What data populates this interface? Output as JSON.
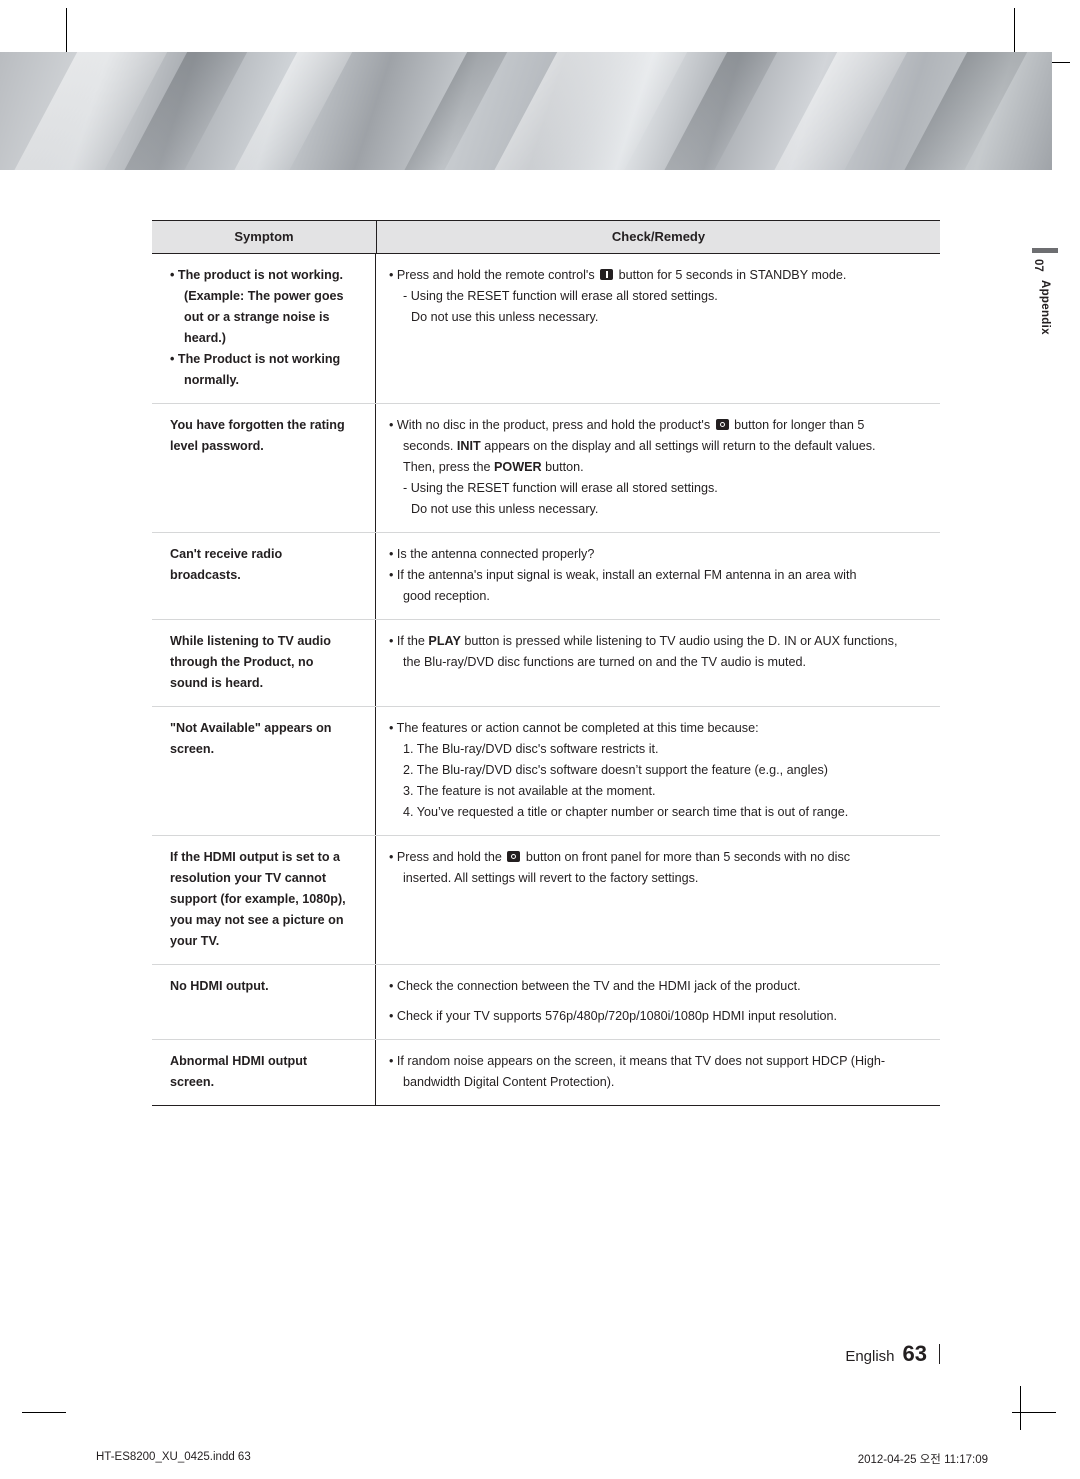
{
  "document": {
    "side_tab": {
      "number": "07",
      "label": "Appendix"
    },
    "table": {
      "headers": {
        "symptom": "Symptom",
        "remedy": "Check/Remedy"
      },
      "rows": [
        {
          "symptom_lines": [
            "• The product is not working.",
            "(Example: The power goes",
            "out or a strange noise is",
            "heard.)",
            "• The Product is not working",
            "normally."
          ],
          "remedy_lines": [
            "• Press and hold the remote control's [BTN] button for 5 seconds in STANDBY mode.",
            "- Using the RESET function will erase all stored settings.",
            "Do not use this unless necessary."
          ]
        },
        {
          "symptom_lines": [
            "You have forgotten the rating",
            "level password."
          ],
          "remedy_lines": [
            "• With no disc in the product, press and hold the product's [BTN] button for longer than 5",
            "seconds. INIT appears on the display and all settings will return to the default values.",
            "Then, press the POWER button.",
            "- Using the RESET function will erase all stored settings.",
            "Do not use this unless necessary."
          ]
        },
        {
          "symptom_lines": [
            "Can't receive radio",
            "broadcasts."
          ],
          "remedy_lines": [
            "• Is the antenna connected properly?",
            "• If the antenna's input signal is weak, install an external FM antenna in an area with",
            "good reception."
          ]
        },
        {
          "symptom_lines": [
            "While listening to TV audio",
            "through the Product, no",
            "sound is heard."
          ],
          "remedy_lines": [
            "• If the PLAY button is pressed while listening to TV audio using the D. IN or AUX functions,",
            "the Blu-ray/DVD disc functions are turned on and the TV audio is muted."
          ]
        },
        {
          "symptom_lines": [
            "\"Not Available\" appears on",
            "screen."
          ],
          "remedy_lines": [
            "• The features or action cannot be completed at this time because:",
            "1. The Blu-ray/DVD disc's software restricts it.",
            "2. The Blu-ray/DVD disc's software doesn’t support the feature (e.g., angles)",
            "3. The feature is not available at the moment.",
            "4. You’ve requested a title or chapter number or search time that is out of range."
          ]
        },
        {
          "symptom_lines": [
            "If the HDMI output is set to a",
            "resolution your TV cannot",
            "support (for example, 1080p),",
            "you may not see a picture on",
            "your TV."
          ],
          "remedy_lines": [
            "• Press and hold the [BTN] button on front panel for more than 5 seconds with no disc",
            "inserted. All settings will revert to the factory settings."
          ]
        },
        {
          "symptom_lines": [
            "No HDMI output."
          ],
          "remedy_lines": [
            "• Check the connection between the TV and the HDMI jack of the product.",
            "• Check if your TV supports 576p/480p/720p/1080i/1080p HDMI input resolution."
          ]
        },
        {
          "symptom_lines": [
            "Abnormal HDMI output",
            "screen."
          ],
          "remedy_lines": [
            "• If random noise appears on the screen, it means that TV does not support HDCP (High-",
            "bandwidth Digital Content Protection)."
          ]
        }
      ]
    },
    "footer": {
      "language": "English",
      "page_number": "63",
      "file_name": "HT-ES8200_XU_0425.indd   63",
      "print_stamp": "2012-04-25   오전 11:17:09"
    }
  }
}
